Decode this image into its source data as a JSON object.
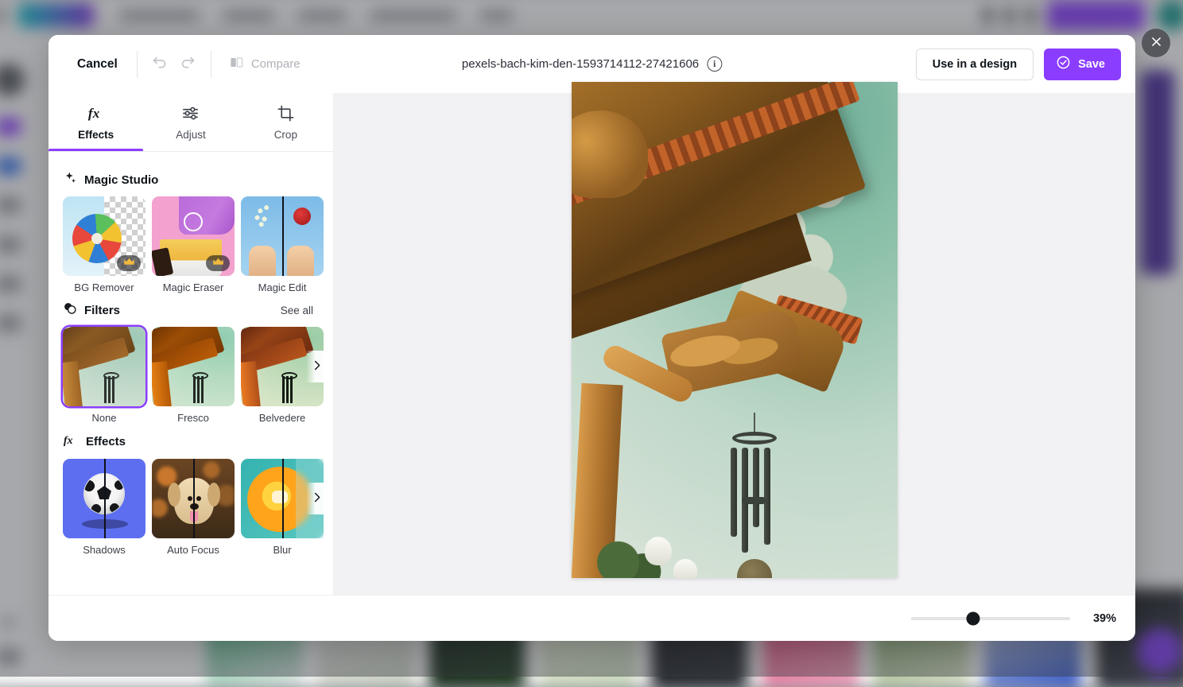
{
  "modal": {
    "header": {
      "cancel_label": "Cancel",
      "undo_icon": "undo-icon",
      "redo_icon": "redo-icon",
      "compare_label": "Compare",
      "compare_icon": "compare-icon",
      "file_name": "pexels-bach-kim-den-1593714112-27421606",
      "info_icon": "i",
      "use_in_design_label": "Use in a design",
      "save_label": "Save",
      "save_icon": "check-circle-icon",
      "accent_color": "#8b3dff"
    },
    "close_label": "×",
    "tabs": [
      {
        "label": "Effects",
        "icon": "fx-icon",
        "active": true
      },
      {
        "label": "Adjust",
        "icon": "sliders-icon",
        "active": false
      },
      {
        "label": "Crop",
        "icon": "crop-icon",
        "active": false
      }
    ],
    "sections": [
      {
        "id": "magic-studio",
        "title": "Magic Studio",
        "icon": "sparkle-icon",
        "see_all": null,
        "has_next_arrow": false,
        "items": [
          {
            "label": "BG Remover",
            "premium": true,
            "art": "bg-remover"
          },
          {
            "label": "Magic Eraser",
            "premium": true,
            "art": "magic-eraser"
          },
          {
            "label": "Magic Edit",
            "premium": false,
            "art": "magic-edit"
          }
        ]
      },
      {
        "id": "filters",
        "title": "Filters",
        "icon": "filters-icon",
        "see_all": "See all",
        "has_next_arrow": true,
        "items": [
          {
            "label": "None",
            "premium": false,
            "art": "photo-none",
            "selected": true
          },
          {
            "label": "Fresco",
            "premium": false,
            "art": "photo-fresco"
          },
          {
            "label": "Belvedere",
            "premium": false,
            "art": "photo-belvedere"
          }
        ]
      },
      {
        "id": "effects",
        "title": "Effects",
        "icon": "fx-icon",
        "see_all": null,
        "has_next_arrow": true,
        "items": [
          {
            "label": "Shadows",
            "premium": false,
            "art": "shadows"
          },
          {
            "label": "Auto Focus",
            "premium": false,
            "art": "auto-focus"
          },
          {
            "label": "Blur",
            "premium": false,
            "art": "blur"
          }
        ]
      }
    ],
    "canvas": {
      "image_alt": "Traditional temple roof with dragon sculpture and wind chimes"
    },
    "footer": {
      "zoom_value": "39%",
      "zoom_percent": 39
    }
  }
}
